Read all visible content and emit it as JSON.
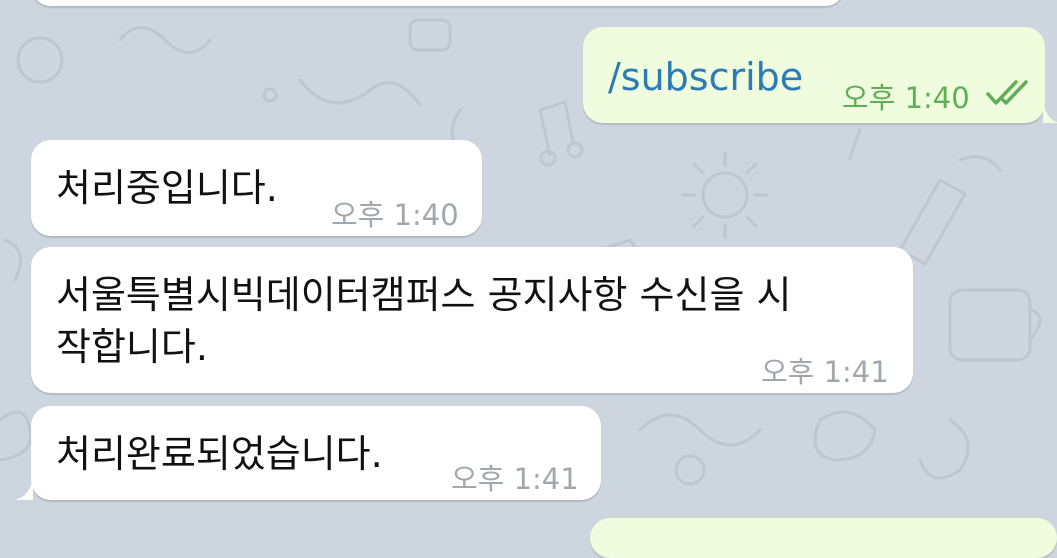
{
  "colors": {
    "chat_background": "#cdd6df",
    "incoming_bubble": "#ffffff",
    "outgoing_bubble": "#effdde",
    "command_link": "#2a7bb8",
    "outgoing_time": "#5fae57",
    "incoming_time": "#a0a8ae"
  },
  "messages": [
    {
      "direction": "outgoing",
      "text": "/subscribe",
      "time": "오후 1:40",
      "status_icon": "double-check-icon"
    },
    {
      "direction": "incoming",
      "text": "처리중입니다.",
      "time": "오후 1:40"
    },
    {
      "direction": "incoming",
      "text_line1": "서울특별시빅데이터캠퍼스 공지사항 수신을 시",
      "text_line2": "작합니다.",
      "time": "오후 1:41"
    },
    {
      "direction": "incoming",
      "text": "처리완료되었습니다.",
      "time": "오후 1:41"
    }
  ]
}
